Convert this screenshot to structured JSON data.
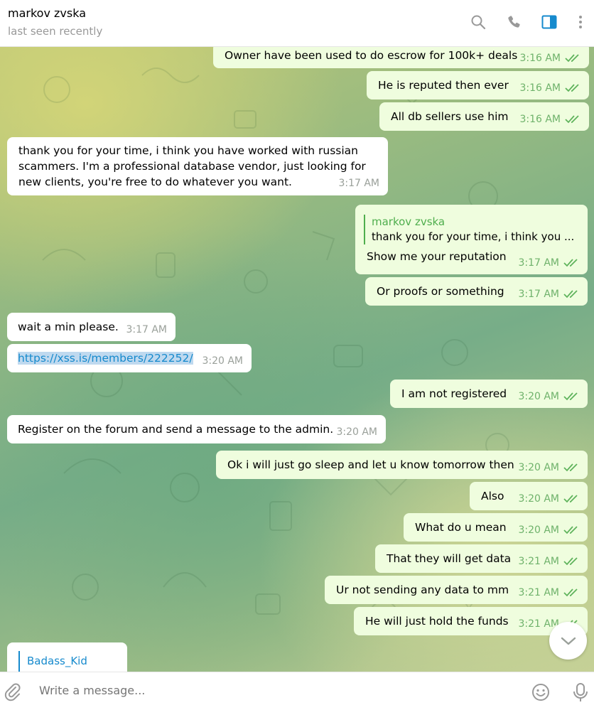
{
  "header": {
    "peer_name": "markov zvska",
    "peer_status": "last seen recently"
  },
  "icons": {
    "search": "search-icon",
    "call": "phone-icon",
    "sidebar": "sidebar-toggle-icon",
    "more": "more-vertical-icon"
  },
  "colors": {
    "outgoing_bubble": "#effdde",
    "incoming_bubble": "#ffffff",
    "accent_green": "#4fae4e",
    "link": "#168acd",
    "panel_icon_active": "#168acd"
  },
  "messages": [
    {
      "dir": "out",
      "text": "Owner have been used to do escrow for 100k+ deals",
      "time": "3:16 AM"
    },
    {
      "dir": "out",
      "text": "He is reputed then ever",
      "time": "3:16 AM"
    },
    {
      "dir": "out",
      "text": "All db sellers use him",
      "time": "3:16 AM"
    },
    {
      "dir": "in",
      "lines": [
        "thank you for your time, i think you have worked with russian",
        "scammers. I'm a professional database vendor, just looking for",
        "new clients, you're free to do whatever you want."
      ],
      "time": "3:17 AM"
    },
    {
      "dir": "out",
      "reply_name": "markov zvska",
      "reply_text": "thank you for your time, i think you ...",
      "text": "Show me your reputation",
      "time": "3:17 AM"
    },
    {
      "dir": "out",
      "text": "Or proofs or something",
      "time": "3:17 AM"
    },
    {
      "dir": "in",
      "text": "wait a min please.",
      "time": "3:17 AM"
    },
    {
      "dir": "in",
      "text": "https://xss.is/members/222252/",
      "time": "3:20 AM",
      "is_link": true
    },
    {
      "dir": "out",
      "text": "I am not registered",
      "time": "3:20 AM"
    },
    {
      "dir": "in",
      "text": "Register on the forum and send a message to the admin.",
      "time": "3:20 AM"
    },
    {
      "dir": "out",
      "text": "Ok i will just go sleep and let u know tomorrow then",
      "time": "3:20 AM"
    },
    {
      "dir": "out",
      "text": "Also",
      "time": "3:20 AM"
    },
    {
      "dir": "out",
      "text": "What do u mean",
      "time": "3:20 AM"
    },
    {
      "dir": "out",
      "text": "That they will get data",
      "time": "3:21 AM"
    },
    {
      "dir": "out",
      "text": "Ur not sending any data to mm",
      "time": "3:21 AM"
    },
    {
      "dir": "out",
      "text": "He will just hold the funds",
      "time": "3:21 AM"
    },
    {
      "dir": "in",
      "reply_name": "Badass_Kid",
      "partial": true
    }
  ],
  "composer": {
    "placeholder": "Write a message..."
  }
}
